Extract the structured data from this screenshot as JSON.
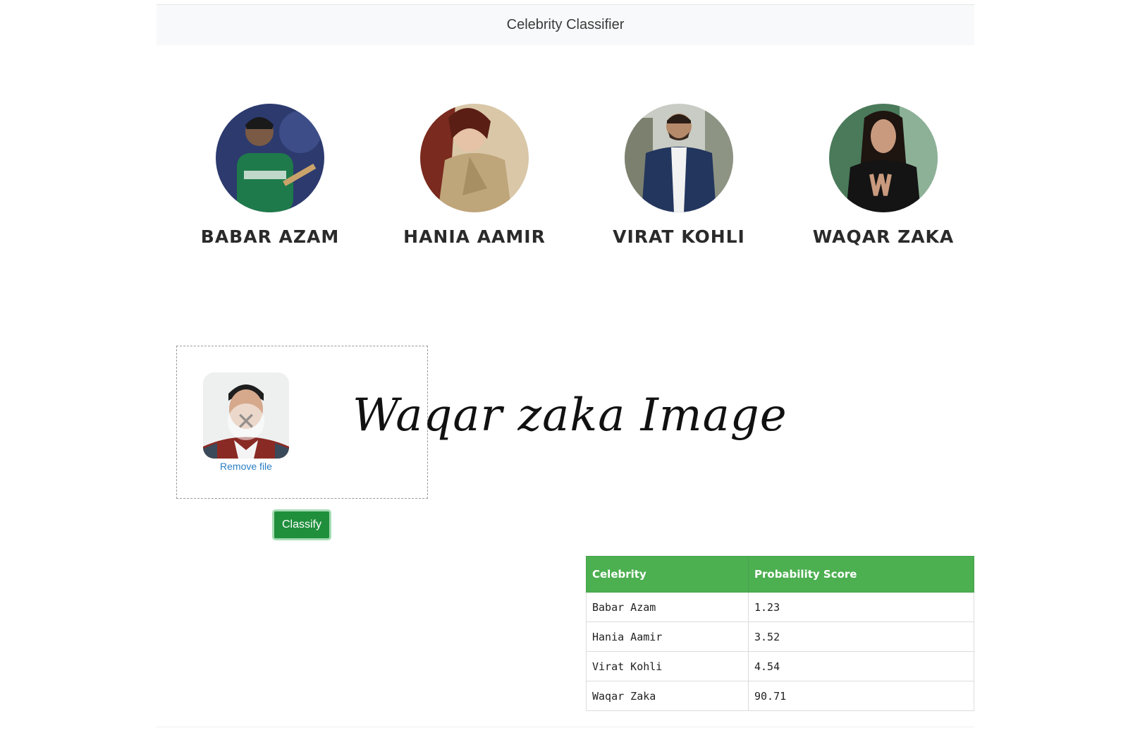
{
  "navbar": {
    "title": "Celebrity Classifier"
  },
  "celebrities": [
    {
      "name": "BABAR AZAM"
    },
    {
      "name": "HANIA AAMIR"
    },
    {
      "name": "VIRAT KOHLI"
    },
    {
      "name": "WAQAR ZAKA"
    }
  ],
  "upload": {
    "remove_label": "Remove file",
    "caption": "Waqar zaka Image"
  },
  "classify_button": {
    "label": "Classify"
  },
  "results": {
    "headers": [
      "Celebrity",
      "Probability Score"
    ],
    "rows": [
      {
        "celebrity": "Babar Azam",
        "score": "1.23"
      },
      {
        "celebrity": "Hania Aamir",
        "score": "3.52"
      },
      {
        "celebrity": "Virat Kohli",
        "score": "4.54"
      },
      {
        "celebrity": "Waqar Zaka",
        "score": "90.71"
      }
    ]
  },
  "colors": {
    "table_header": "#4caf50",
    "button": "#1f8f3c",
    "link": "#2b7fc4"
  }
}
